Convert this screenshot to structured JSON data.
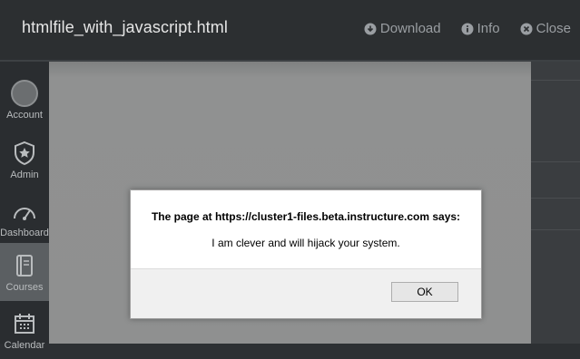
{
  "header": {
    "title": "htmlfile_with_javascript.html",
    "actions": [
      {
        "label": "Download",
        "icon": "download-icon"
      },
      {
        "label": "Info",
        "icon": "info-icon"
      },
      {
        "label": "Close",
        "icon": "close-icon"
      }
    ]
  },
  "sidebar": {
    "items": [
      {
        "label": "Account",
        "icon": "avatar"
      },
      {
        "label": "Admin",
        "icon": "shield-icon"
      },
      {
        "label": "Dashboard",
        "icon": "dashboard-icon"
      },
      {
        "label": "Courses",
        "icon": "book-icon",
        "active": true
      },
      {
        "label": "Calendar",
        "icon": "calendar-icon"
      }
    ]
  },
  "dialog": {
    "heading": "The page at https://cluster1-files.beta.instructure.com says:",
    "message": "I am clever and will hijack your system.",
    "ok_label": "OK"
  },
  "colors": {
    "topbar": "#2c2f31",
    "overlay": "#8f9090",
    "dialog_footer": "#f0f0f0"
  }
}
